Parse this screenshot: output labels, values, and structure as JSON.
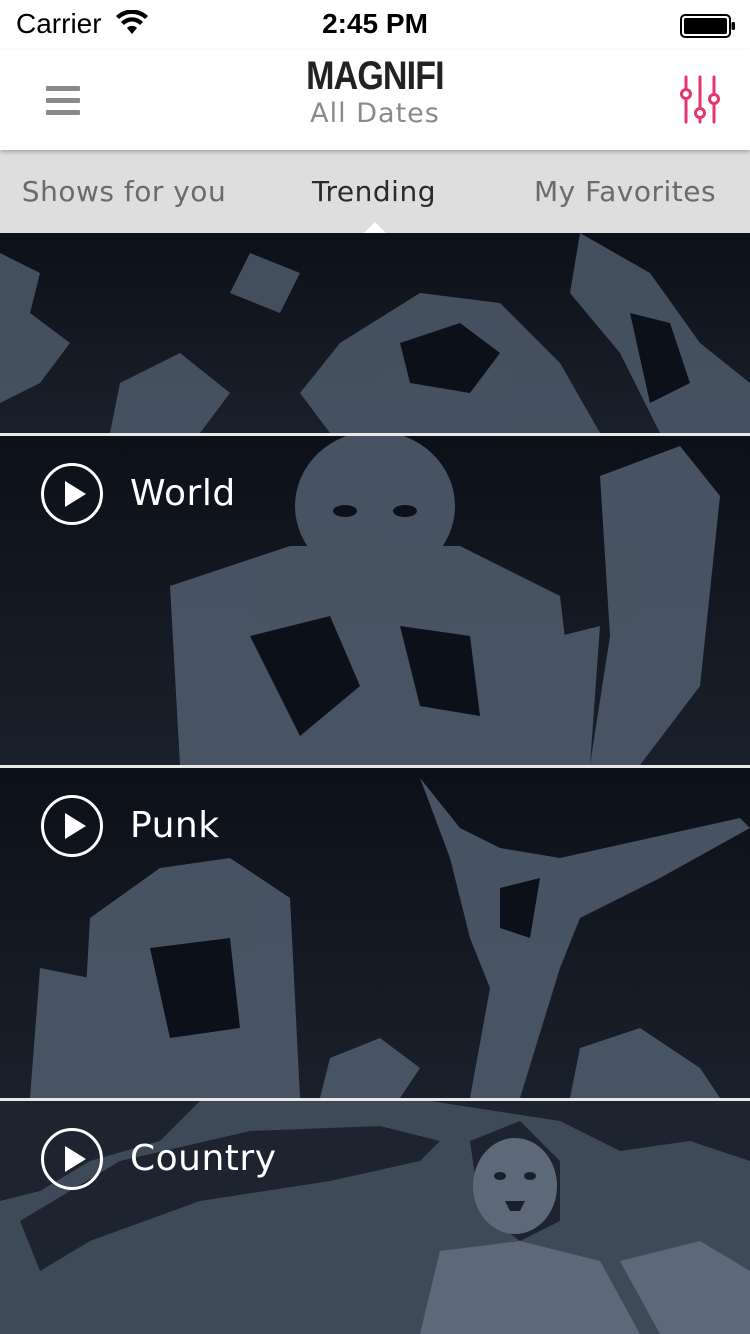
{
  "status_bar": {
    "carrier": "Carrier",
    "time": "2:45 PM"
  },
  "header": {
    "logo": "MAGNIFI",
    "subtitle": "All Dates",
    "menu_icon": "hamburger-menu-icon",
    "filter_icon": "sliders-filter-icon"
  },
  "tabs": [
    {
      "label": "Shows for you",
      "active": false
    },
    {
      "label": "Trending",
      "active": true
    },
    {
      "label": "My Favorites",
      "active": false
    }
  ],
  "genres": [
    {
      "label": "World"
    },
    {
      "label": "Punk"
    },
    {
      "label": "Country"
    }
  ],
  "colors": {
    "accent": "#e8346b",
    "tab_bar": "#dedede",
    "card_bg": "#10141d",
    "art_tone": "#4e5a6a"
  }
}
